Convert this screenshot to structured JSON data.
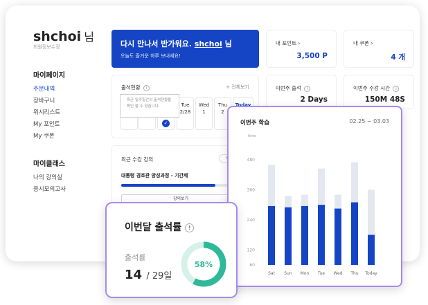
{
  "profile": {
    "username": "shchoi",
    "suffix": "님",
    "link": "회원정보수정"
  },
  "sidebar": {
    "sections": [
      {
        "title": "마이페이지",
        "items": [
          {
            "label": "주문내역",
            "active": true
          },
          {
            "label": "장바구니"
          },
          {
            "label": "위시리스트"
          },
          {
            "label": "My 포인트"
          },
          {
            "label": "My 쿠폰"
          }
        ]
      },
      {
        "title": "마이클래스",
        "items": [
          {
            "label": "나의 강의실"
          },
          {
            "label": "응시모의고사"
          }
        ]
      }
    ]
  },
  "welcome": {
    "greeting": "다시 만나서 반가워요.",
    "username": "shchoi",
    "suffix": "님",
    "subtitle": "오늘도 즐거운 하루 보내세요!"
  },
  "stats": {
    "points": {
      "label": "내 포인트",
      "value": "3,500 P"
    },
    "coupons": {
      "label": "내 쿠폰",
      "value": "4 개"
    },
    "weekly_attendance": {
      "label": "이번주 출석",
      "value": "2 Days"
    },
    "weekly_time": {
      "label": "이번주 수강 시간",
      "value": "150M 48S"
    }
  },
  "attendance": {
    "title": "출석현황",
    "more": "+ 전체보기",
    "tooltip": "최근 일주일간의 출석현황을 확인 할 수 있습니다.",
    "days": [
      {
        "name": "",
        "date": ""
      },
      {
        "name": "",
        "date": ""
      },
      {
        "name": "",
        "date": ""
      },
      {
        "name": "Tue",
        "date": "2/28"
      },
      {
        "name": "Wed",
        "date": "1"
      },
      {
        "name": "Thu",
        "date": "2"
      },
      {
        "name": "Today",
        "date": "",
        "today": true
      }
    ]
  },
  "recent_course": {
    "title": "최근 수강 강의",
    "badge": "40",
    "name": "대통령 경호관 양성과정 - 기간제",
    "progress": 0.85,
    "button": "강의보기"
  },
  "weekly_chart": {
    "title": "이번주 학습",
    "range": "02.25 ~ 03.03"
  },
  "chart_data": {
    "type": "bar",
    "ylabel": "time",
    "ylim": [
      60,
      480
    ],
    "yticks": [
      60,
      120,
      240,
      360,
      480
    ],
    "categories": [
      "Sat",
      "Sun",
      "Mon",
      "Tue",
      "Wed",
      "Thu",
      "Today"
    ],
    "series": [
      {
        "values": [
          460,
          335,
          340,
          445,
          340,
          470,
          360
        ]
      },
      {
        "values": [
          295,
          290,
          295,
          300,
          285,
          310,
          180
        ]
      }
    ],
    "colors": {
      "background": "#e3e8f0",
      "foreground": "#1544c4"
    }
  },
  "monthly_attendance": {
    "title": "이번달 출석률",
    "rate_label": "출석률",
    "count": "14",
    "total": "/ 29일",
    "percent_text": "58%",
    "percent": 0.58,
    "color": "#2fb89a"
  }
}
